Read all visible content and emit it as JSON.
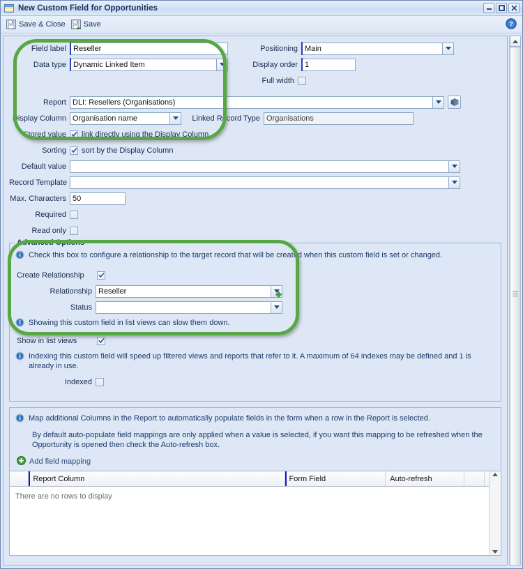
{
  "window": {
    "title": "New Custom Field for Opportunities",
    "icon": "form-window-icon",
    "minimize_label": "Minimize",
    "maximize_label": "Maximize",
    "close_label": "Close"
  },
  "toolbar": {
    "save_close_label": "Save & Close",
    "save_label": "Save",
    "help_label": "?"
  },
  "form": {
    "field_label": {
      "label": "Field label",
      "value": "Reseller"
    },
    "data_type": {
      "label": "Data type",
      "value": "Dynamic Linked Item"
    },
    "positioning": {
      "label": "Positioning",
      "value": "Main"
    },
    "display_order": {
      "label": "Display order",
      "value": "1"
    },
    "full_width": {
      "label": "Full width",
      "checked": false
    },
    "report": {
      "label": "Report",
      "value": "DLI: Resellers (Organisations)"
    },
    "display_column": {
      "label": "Display Column",
      "value": "Organisation name"
    },
    "linked_record_type": {
      "label": "Linked Record Type",
      "value": "Organisations"
    },
    "stored_value": {
      "label": "Stored value",
      "text": "link directly using the Display Column",
      "checked": true
    },
    "sorting": {
      "label": "Sorting",
      "text": "sort by the Display Column",
      "checked": true
    },
    "default_value": {
      "label": "Default value",
      "value": ""
    },
    "record_template": {
      "label": "Record Template",
      "value": ""
    },
    "max_characters": {
      "label": "Max. Characters",
      "value": "50"
    },
    "required": {
      "label": "Required",
      "checked": false
    },
    "read_only": {
      "label": "Read only",
      "checked": false
    }
  },
  "advanced": {
    "title": "Advanced Options",
    "info": "Check this box to configure a relationship to the target record that will be created when this custom field is set or changed.",
    "create_relationship": {
      "label": "Create Relationship",
      "checked": true
    },
    "relationship": {
      "label": "Relationship",
      "value": "Reseller"
    },
    "status": {
      "label": "Status",
      "value": ""
    },
    "list_views_info": "Showing this custom field in list views can slow them down.",
    "show_in_list_views": {
      "label": "Show in list views",
      "checked": true
    },
    "indexing_info": "Indexing this custom field will speed up filtered views and reports that refer to it. A maximum of 64 indexes may be defined and 1 is already in use.",
    "indexed": {
      "label": "Indexed",
      "checked": false
    }
  },
  "mapping": {
    "info": "Map additional Columns in the Report to automatically populate fields in the form when a row in the Report is selected.",
    "note": "By default auto-populate field mappings are only applied when a value is selected, if you want this mapping to be refreshed when the Opportunity is opened then check the Auto-refresh box.",
    "add_label": "Add field mapping",
    "columns": [
      "Report Column",
      "Form Field",
      "Auto-refresh"
    ],
    "empty_message": "There are no rows to display",
    "rows": []
  },
  "annotations": {
    "highlight_color": "#57a845",
    "regions": [
      {
        "name": "field-definition-highlight"
      },
      {
        "name": "advanced-options-highlight"
      }
    ]
  }
}
